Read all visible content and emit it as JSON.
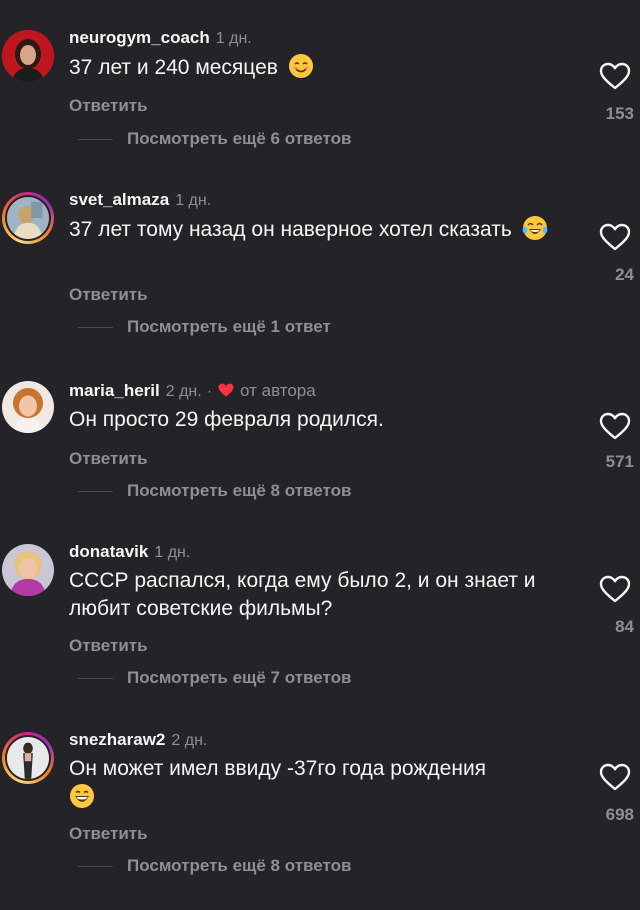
{
  "colors": {
    "background": "#242428",
    "primary_text": "#f5f5f5",
    "secondary_text": "#8e8e93",
    "author_heart": "#ff3040"
  },
  "comments": [
    {
      "username": "neurogym_coach",
      "time": "1 дн.",
      "text": "37 лет и 240 месяцев",
      "emoji": "smiling-face-icon",
      "reply_label": "Ответить",
      "view_replies": "Посмотреть ещё 6 ответов",
      "likes": "153",
      "story_ring": false
    },
    {
      "username": "svet_almaza",
      "time": "1 дн.",
      "text": "37 лет тому назад он наверное хотел сказать",
      "emoji": "tears-of-joy-icon",
      "reply_label": "Ответить",
      "view_replies": "Посмотреть ещё 1 ответ",
      "likes": "24",
      "story_ring": true
    },
    {
      "username": "maria_heril",
      "time": "2 дн.",
      "separator": "·",
      "author_label": "от автора",
      "text": "Он просто 29 февраля родился.",
      "reply_label": "Ответить",
      "view_replies": "Посмотреть ещё 8 ответов",
      "likes": "571",
      "story_ring": false
    },
    {
      "username": "donatavik",
      "time": "1 дн.",
      "text": "СССР распался, когда ему было 2, и он знает и любит советские фильмы?",
      "reply_label": "Ответить",
      "view_replies": "Посмотреть ещё 7 ответов",
      "likes": "84",
      "story_ring": false
    },
    {
      "username": "snezharaw2",
      "time": "2 дн.",
      "text": "Он может имел ввиду -37го года рождения",
      "emoji": "grinning-face-icon",
      "reply_label": "Ответить",
      "view_replies": "Посмотреть ещё 8 ответов",
      "likes": "698",
      "story_ring": true
    }
  ]
}
